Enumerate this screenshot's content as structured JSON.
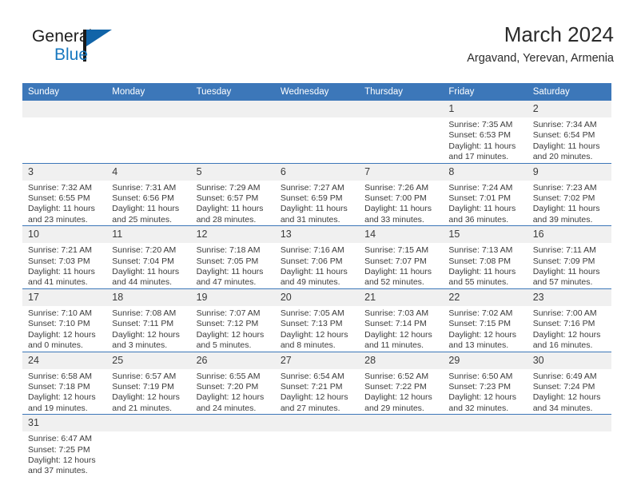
{
  "brand": {
    "name_part1": "General",
    "name_part2": "Blue",
    "logo_icon": "triangle-logo-icon",
    "colors": {
      "black": "#1c1c1c",
      "blue": "#1878bf",
      "triangle": "#1164a8"
    }
  },
  "header": {
    "title": "March 2024",
    "subtitle": "Argavand, Yerevan, Armenia"
  },
  "theme": {
    "header_blue": "#3c77b9",
    "daynum_gray": "#f0f0f0",
    "text": "#3b3b3b"
  },
  "weekdays": [
    {
      "label": "Sunday"
    },
    {
      "label": "Monday"
    },
    {
      "label": "Tuesday"
    },
    {
      "label": "Wednesday"
    },
    {
      "label": "Thursday"
    },
    {
      "label": "Friday"
    },
    {
      "label": "Saturday"
    }
  ],
  "weeks": [
    [
      {
        "day": "",
        "sunrise": "",
        "sunset": "",
        "daylight1": "",
        "daylight2": ""
      },
      {
        "day": "",
        "sunrise": "",
        "sunset": "",
        "daylight1": "",
        "daylight2": ""
      },
      {
        "day": "",
        "sunrise": "",
        "sunset": "",
        "daylight1": "",
        "daylight2": ""
      },
      {
        "day": "",
        "sunrise": "",
        "sunset": "",
        "daylight1": "",
        "daylight2": ""
      },
      {
        "day": "",
        "sunrise": "",
        "sunset": "",
        "daylight1": "",
        "daylight2": ""
      },
      {
        "day": "1",
        "sunrise": "Sunrise: 7:35 AM",
        "sunset": "Sunset: 6:53 PM",
        "daylight1": "Daylight: 11 hours",
        "daylight2": "and 17 minutes."
      },
      {
        "day": "2",
        "sunrise": "Sunrise: 7:34 AM",
        "sunset": "Sunset: 6:54 PM",
        "daylight1": "Daylight: 11 hours",
        "daylight2": "and 20 minutes."
      }
    ],
    [
      {
        "day": "3",
        "sunrise": "Sunrise: 7:32 AM",
        "sunset": "Sunset: 6:55 PM",
        "daylight1": "Daylight: 11 hours",
        "daylight2": "and 23 minutes."
      },
      {
        "day": "4",
        "sunrise": "Sunrise: 7:31 AM",
        "sunset": "Sunset: 6:56 PM",
        "daylight1": "Daylight: 11 hours",
        "daylight2": "and 25 minutes."
      },
      {
        "day": "5",
        "sunrise": "Sunrise: 7:29 AM",
        "sunset": "Sunset: 6:57 PM",
        "daylight1": "Daylight: 11 hours",
        "daylight2": "and 28 minutes."
      },
      {
        "day": "6",
        "sunrise": "Sunrise: 7:27 AM",
        "sunset": "Sunset: 6:59 PM",
        "daylight1": "Daylight: 11 hours",
        "daylight2": "and 31 minutes."
      },
      {
        "day": "7",
        "sunrise": "Sunrise: 7:26 AM",
        "sunset": "Sunset: 7:00 PM",
        "daylight1": "Daylight: 11 hours",
        "daylight2": "and 33 minutes."
      },
      {
        "day": "8",
        "sunrise": "Sunrise: 7:24 AM",
        "sunset": "Sunset: 7:01 PM",
        "daylight1": "Daylight: 11 hours",
        "daylight2": "and 36 minutes."
      },
      {
        "day": "9",
        "sunrise": "Sunrise: 7:23 AM",
        "sunset": "Sunset: 7:02 PM",
        "daylight1": "Daylight: 11 hours",
        "daylight2": "and 39 minutes."
      }
    ],
    [
      {
        "day": "10",
        "sunrise": "Sunrise: 7:21 AM",
        "sunset": "Sunset: 7:03 PM",
        "daylight1": "Daylight: 11 hours",
        "daylight2": "and 41 minutes."
      },
      {
        "day": "11",
        "sunrise": "Sunrise: 7:20 AM",
        "sunset": "Sunset: 7:04 PM",
        "daylight1": "Daylight: 11 hours",
        "daylight2": "and 44 minutes."
      },
      {
        "day": "12",
        "sunrise": "Sunrise: 7:18 AM",
        "sunset": "Sunset: 7:05 PM",
        "daylight1": "Daylight: 11 hours",
        "daylight2": "and 47 minutes."
      },
      {
        "day": "13",
        "sunrise": "Sunrise: 7:16 AM",
        "sunset": "Sunset: 7:06 PM",
        "daylight1": "Daylight: 11 hours",
        "daylight2": "and 49 minutes."
      },
      {
        "day": "14",
        "sunrise": "Sunrise: 7:15 AM",
        "sunset": "Sunset: 7:07 PM",
        "daylight1": "Daylight: 11 hours",
        "daylight2": "and 52 minutes."
      },
      {
        "day": "15",
        "sunrise": "Sunrise: 7:13 AM",
        "sunset": "Sunset: 7:08 PM",
        "daylight1": "Daylight: 11 hours",
        "daylight2": "and 55 minutes."
      },
      {
        "day": "16",
        "sunrise": "Sunrise: 7:11 AM",
        "sunset": "Sunset: 7:09 PM",
        "daylight1": "Daylight: 11 hours",
        "daylight2": "and 57 minutes."
      }
    ],
    [
      {
        "day": "17",
        "sunrise": "Sunrise: 7:10 AM",
        "sunset": "Sunset: 7:10 PM",
        "daylight1": "Daylight: 12 hours",
        "daylight2": "and 0 minutes."
      },
      {
        "day": "18",
        "sunrise": "Sunrise: 7:08 AM",
        "sunset": "Sunset: 7:11 PM",
        "daylight1": "Daylight: 12 hours",
        "daylight2": "and 3 minutes."
      },
      {
        "day": "19",
        "sunrise": "Sunrise: 7:07 AM",
        "sunset": "Sunset: 7:12 PM",
        "daylight1": "Daylight: 12 hours",
        "daylight2": "and 5 minutes."
      },
      {
        "day": "20",
        "sunrise": "Sunrise: 7:05 AM",
        "sunset": "Sunset: 7:13 PM",
        "daylight1": "Daylight: 12 hours",
        "daylight2": "and 8 minutes."
      },
      {
        "day": "21",
        "sunrise": "Sunrise: 7:03 AM",
        "sunset": "Sunset: 7:14 PM",
        "daylight1": "Daylight: 12 hours",
        "daylight2": "and 11 minutes."
      },
      {
        "day": "22",
        "sunrise": "Sunrise: 7:02 AM",
        "sunset": "Sunset: 7:15 PM",
        "daylight1": "Daylight: 12 hours",
        "daylight2": "and 13 minutes."
      },
      {
        "day": "23",
        "sunrise": "Sunrise: 7:00 AM",
        "sunset": "Sunset: 7:16 PM",
        "daylight1": "Daylight: 12 hours",
        "daylight2": "and 16 minutes."
      }
    ],
    [
      {
        "day": "24",
        "sunrise": "Sunrise: 6:58 AM",
        "sunset": "Sunset: 7:18 PM",
        "daylight1": "Daylight: 12 hours",
        "daylight2": "and 19 minutes."
      },
      {
        "day": "25",
        "sunrise": "Sunrise: 6:57 AM",
        "sunset": "Sunset: 7:19 PM",
        "daylight1": "Daylight: 12 hours",
        "daylight2": "and 21 minutes."
      },
      {
        "day": "26",
        "sunrise": "Sunrise: 6:55 AM",
        "sunset": "Sunset: 7:20 PM",
        "daylight1": "Daylight: 12 hours",
        "daylight2": "and 24 minutes."
      },
      {
        "day": "27",
        "sunrise": "Sunrise: 6:54 AM",
        "sunset": "Sunset: 7:21 PM",
        "daylight1": "Daylight: 12 hours",
        "daylight2": "and 27 minutes."
      },
      {
        "day": "28",
        "sunrise": "Sunrise: 6:52 AM",
        "sunset": "Sunset: 7:22 PM",
        "daylight1": "Daylight: 12 hours",
        "daylight2": "and 29 minutes."
      },
      {
        "day": "29",
        "sunrise": "Sunrise: 6:50 AM",
        "sunset": "Sunset: 7:23 PM",
        "daylight1": "Daylight: 12 hours",
        "daylight2": "and 32 minutes."
      },
      {
        "day": "30",
        "sunrise": "Sunrise: 6:49 AM",
        "sunset": "Sunset: 7:24 PM",
        "daylight1": "Daylight: 12 hours",
        "daylight2": "and 34 minutes."
      }
    ],
    [
      {
        "day": "31",
        "sunrise": "Sunrise: 6:47 AM",
        "sunset": "Sunset: 7:25 PM",
        "daylight1": "Daylight: 12 hours",
        "daylight2": "and 37 minutes."
      },
      {
        "day": "",
        "sunrise": "",
        "sunset": "",
        "daylight1": "",
        "daylight2": ""
      },
      {
        "day": "",
        "sunrise": "",
        "sunset": "",
        "daylight1": "",
        "daylight2": ""
      },
      {
        "day": "",
        "sunrise": "",
        "sunset": "",
        "daylight1": "",
        "daylight2": ""
      },
      {
        "day": "",
        "sunrise": "",
        "sunset": "",
        "daylight1": "",
        "daylight2": ""
      },
      {
        "day": "",
        "sunrise": "",
        "sunset": "",
        "daylight1": "",
        "daylight2": ""
      },
      {
        "day": "",
        "sunrise": "",
        "sunset": "",
        "daylight1": "",
        "daylight2": ""
      }
    ]
  ]
}
